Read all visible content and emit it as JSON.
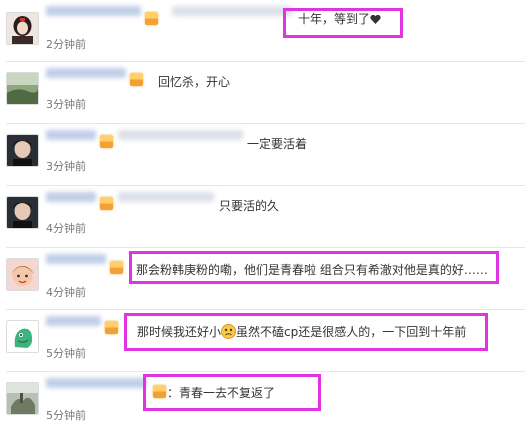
{
  "comments": [
    {
      "text": "十年，等到了",
      "time": "2分钟前",
      "emoji": "heart-icon"
    },
    {
      "text": "回忆杀，开心",
      "time": "3分钟前"
    },
    {
      "text": "一定要活着",
      "time": "3分钟前"
    },
    {
      "text": "只要活的久",
      "time": "4分钟前"
    },
    {
      "text": "那会粉韩庚粉的嘞，他们是青春啦 组合只有希澈对他是真的好……",
      "time": "4分钟前"
    },
    {
      "text_before": "那时候我还好小",
      "text_after": "虽然不磕cp还是很感人的，一下回到十年前",
      "time": "5分钟前",
      "emoji": "sad-face-icon"
    },
    {
      "text": "：青春一去不复返了",
      "time": "5分钟前"
    }
  ],
  "colors": {
    "highlight": "#e233e2",
    "badge": "#f3a035",
    "text": "#333333",
    "timestamp": "#777777",
    "divider": "#e6e6e6"
  }
}
